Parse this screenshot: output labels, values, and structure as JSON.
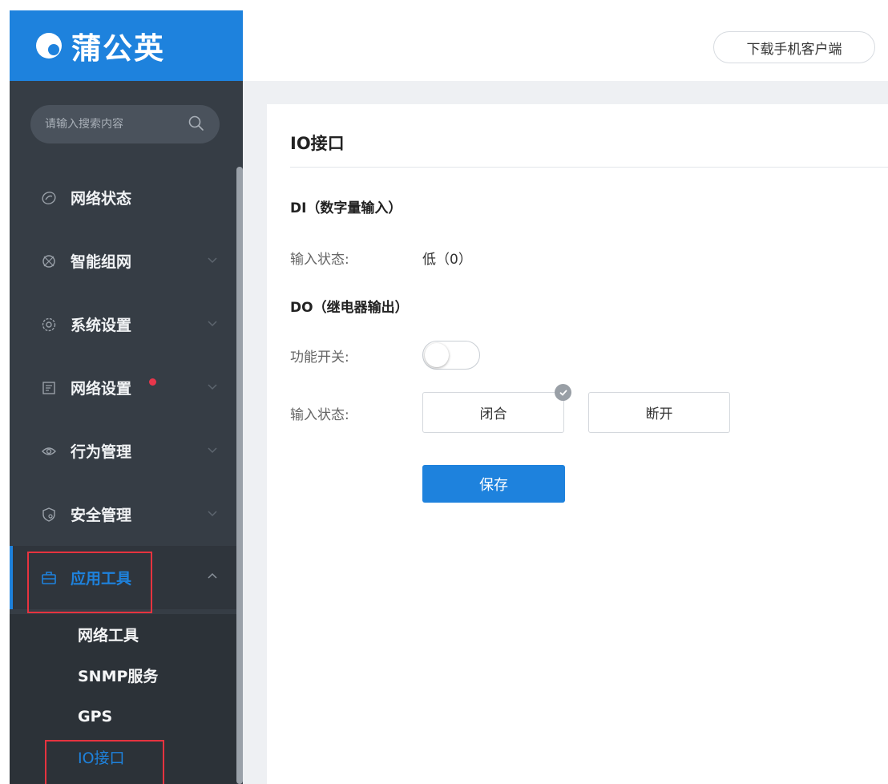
{
  "brand": {
    "name": "蒲公英"
  },
  "search": {
    "placeholder": "请输入搜索内容"
  },
  "sidebar": {
    "items": [
      {
        "label": "网络状态",
        "icon": "network-status-icon"
      },
      {
        "label": "智能组网",
        "icon": "smart-network-icon"
      },
      {
        "label": "系统设置",
        "icon": "gear-icon"
      },
      {
        "label": "网络设置",
        "icon": "document-icon",
        "has_notification": true
      },
      {
        "label": "行为管理",
        "icon": "eye-icon"
      },
      {
        "label": "安全管理",
        "icon": "shield-icon"
      },
      {
        "label": "应用工具",
        "icon": "toolbox-icon",
        "active": true,
        "expanded": true
      }
    ],
    "submenu": [
      {
        "label": "网络工具"
      },
      {
        "label": "SNMP服务"
      },
      {
        "label": "GPS"
      },
      {
        "label": "IO接口",
        "active": true
      }
    ]
  },
  "header": {
    "download_label": "下载手机客户端"
  },
  "main": {
    "title": "IO接口",
    "di": {
      "section_title": "DI（数字量输入）",
      "input_state_label": "输入状态:",
      "input_state_value": "低（0）"
    },
    "do": {
      "section_title": "DO（继电器输出）",
      "function_switch_label": "功能开关:",
      "function_switch_on": false,
      "input_state_label": "输入状态:",
      "options": [
        "闭合",
        "断开"
      ],
      "selected_option": "闭合"
    },
    "save_label": "保存"
  },
  "colors": {
    "brand_blue": "#1e82dd",
    "sidebar_bg": "#363d45",
    "highlight_red": "#e6333f",
    "notification_red": "#e8364b"
  }
}
